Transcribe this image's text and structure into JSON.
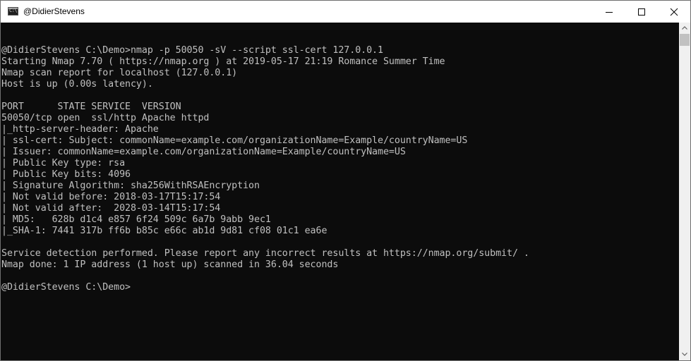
{
  "window": {
    "title": "@DidierStevens",
    "icon": "cmd-console-icon",
    "icon_prompt": "C:\\"
  },
  "title_buttons": {
    "minimize": "minimize-icon",
    "maximize": "maximize-icon",
    "close": "close-icon"
  },
  "console": {
    "background": "#0c0c0c",
    "foreground": "#c0c0c0",
    "lines": [
      "",
      "@DidierStevens C:\\Demo>nmap -p 50050 -sV --script ssl-cert 127.0.0.1",
      "Starting Nmap 7.70 ( https://nmap.org ) at 2019-05-17 21:19 Romance Summer Time",
      "Nmap scan report for localhost (127.0.0.1)",
      "Host is up (0.00s latency).",
      "",
      "PORT      STATE SERVICE  VERSION",
      "50050/tcp open  ssl/http Apache httpd",
      "|_http-server-header: Apache",
      "| ssl-cert: Subject: commonName=example.com/organizationName=Example/countryName=US",
      "| Issuer: commonName=example.com/organizationName=Example/countryName=US",
      "| Public Key type: rsa",
      "| Public Key bits: 4096",
      "| Signature Algorithm: sha256WithRSAEncryption",
      "| Not valid before: 2018-03-17T15:17:54",
      "| Not valid after:  2028-03-14T15:17:54",
      "| MD5:   628b d1c4 e857 6f24 509c 6a7b 9abb 9ec1",
      "|_SHA-1: 7441 317b ff6b b85c e66c ab1d 9d81 cf08 01c1 ea6e",
      "",
      "Service detection performed. Please report any incorrect results at https://nmap.org/submit/ .",
      "Nmap done: 1 IP address (1 host up) scanned in 36.04 seconds",
      "",
      "@DidierStevens C:\\Demo>"
    ]
  },
  "scrollbar": {
    "up": "scroll-up-arrow-icon",
    "down": "scroll-down-arrow-icon"
  }
}
